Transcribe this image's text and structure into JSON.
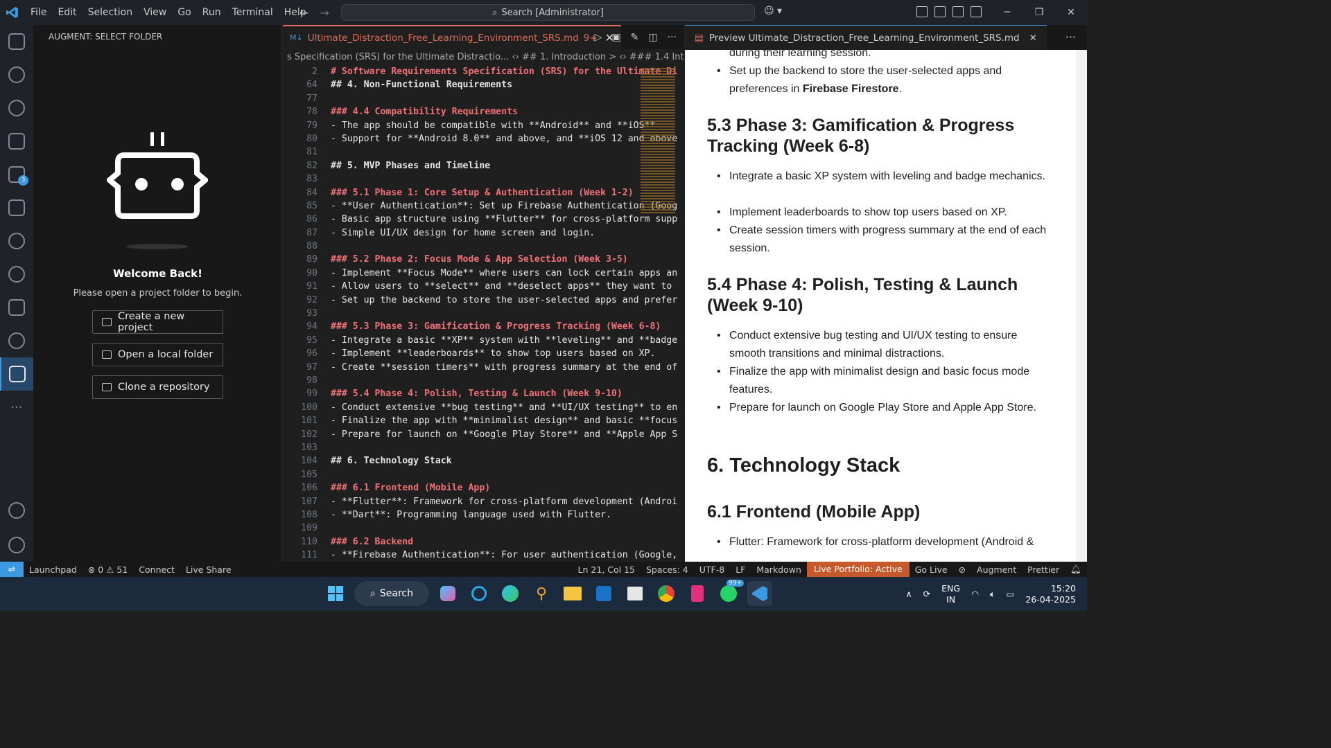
{
  "menu": [
    "File",
    "Edit",
    "Selection",
    "View",
    "Go",
    "Run",
    "Terminal",
    "Help"
  ],
  "search": "Search [Administrator]",
  "sidebar": {
    "title": "AUGMENT: SELECT FOLDER",
    "welcome": "Welcome Back!",
    "subtitle": "Please open a project folder to begin.",
    "buttons": [
      "Create a new project",
      "Open a local folder",
      "Clone a repository"
    ],
    "extensions_badge": "3"
  },
  "editor": {
    "tab_label": "Ultimate_Distraction_Free_Learning_Environment_SRS.md",
    "tab_badge": "9+",
    "breadcrumb": "s Specification (SRS) for the Ultimate Distractio...  ‹› ## 1. Introduction  >  ‹› ### 1.4 Intended Au",
    "lines": [
      {
        "n": "2",
        "t": "# Software Requirements Specification (SRS) for the Ultimate Di",
        "k": "h1"
      },
      {
        "n": "64",
        "t": "## 4. Non-Functional Requirements",
        "k": "h2"
      },
      {
        "n": "77",
        "t": "",
        "k": ""
      },
      {
        "n": "78",
        "t": "### 4.4 Compatibility Requirements",
        "k": "h3"
      },
      {
        "n": "79",
        "t": "- The app should be compatible with **Android** and **iOS**",
        "k": "li"
      },
      {
        "n": "80",
        "t": "- Support for **Android 8.0** and above, and **iOS 12 and above",
        "k": "li"
      },
      {
        "n": "81",
        "t": "",
        "k": ""
      },
      {
        "n": "82",
        "t": "## 5. MVP Phases and Timeline",
        "k": "h2"
      },
      {
        "n": "83",
        "t": "",
        "k": ""
      },
      {
        "n": "84",
        "t": "### 5.1 Phase 1: Core Setup & Authentication (Week 1-2)",
        "k": "h3"
      },
      {
        "n": "85",
        "t": "- **User Authentication**: Set up Firebase Authentication (Goog",
        "k": "li"
      },
      {
        "n": "86",
        "t": "- Basic app structure using **Flutter** for cross-platform supp",
        "k": "li"
      },
      {
        "n": "87",
        "t": "- Simple UI/UX design for home screen and login.",
        "k": "li"
      },
      {
        "n": "88",
        "t": "",
        "k": ""
      },
      {
        "n": "89",
        "t": "### 5.2 Phase 2: Focus Mode & App Selection (Week 3-5)",
        "k": "h3"
      },
      {
        "n": "90",
        "t": "- Implement **Focus Mode** where users can lock certain apps an",
        "k": "li"
      },
      {
        "n": "91",
        "t": "- Allow users to **select** and **deselect apps** they want to",
        "k": "li"
      },
      {
        "n": "92",
        "t": "- Set up the backend to store the user-selected apps and prefer",
        "k": "li"
      },
      {
        "n": "93",
        "t": "",
        "k": ""
      },
      {
        "n": "94",
        "t": "### 5.3 Phase 3: Gamification & Progress Tracking (Week 6-8)",
        "k": "h3"
      },
      {
        "n": "95",
        "t": "- Integrate a basic **XP** system with **leveling** and **badge",
        "k": "li"
      },
      {
        "n": "96",
        "t": "- Implement **leaderboards** to show top users based on XP.",
        "k": "li"
      },
      {
        "n": "97",
        "t": "- Create **session timers** with progress summary at the end of",
        "k": "li"
      },
      {
        "n": "98",
        "t": "",
        "k": ""
      },
      {
        "n": "99",
        "t": "### 5.4 Phase 4: Polish, Testing & Launch (Week 9-10)",
        "k": "h3"
      },
      {
        "n": "100",
        "t": "- Conduct extensive **bug testing** and **UI/UX testing** to en",
        "k": "li"
      },
      {
        "n": "101",
        "t": "- Finalize the app with **minimalist design** and basic **focus",
        "k": "li"
      },
      {
        "n": "102",
        "t": "- Prepare for launch on **Google Play Store** and **Apple App S",
        "k": "li"
      },
      {
        "n": "103",
        "t": "",
        "k": ""
      },
      {
        "n": "104",
        "t": "## 6. Technology Stack",
        "k": "h2"
      },
      {
        "n": "105",
        "t": "",
        "k": ""
      },
      {
        "n": "106",
        "t": "### 6.1 Frontend (Mobile App)",
        "k": "h3"
      },
      {
        "n": "107",
        "t": "- **Flutter**: Framework for cross-platform development (Androi",
        "k": "li"
      },
      {
        "n": "108",
        "t": "- **Dart**: Programming language used with Flutter.",
        "k": "li"
      },
      {
        "n": "109",
        "t": "",
        "k": ""
      },
      {
        "n": "110",
        "t": "### 6.2 Backend",
        "k": "h3"
      },
      {
        "n": "111",
        "t": "- **Firebase Authentication**: For user authentication (Google,",
        "k": "li"
      }
    ]
  },
  "preview": {
    "tab_label": "Preview Ultimate_Distraction_Free_Learning_Environment_SRS.md",
    "p_top": "during their learning session.",
    "p_backend_a": "Set up the backend to store the user-selected apps and preferences in ",
    "p_backend_b": "Firebase Firestore",
    "h53": "5.3 Phase 3: Gamification & Progress Tracking (Week 6-8)",
    "p53a": "Integrate a basic XP system with leveling and badge mechanics.",
    "p53b": "Implement leaderboards to show top users based on XP.",
    "p53c": "Create session timers with progress summary at the end of each session.",
    "h54": "5.4 Phase 4: Polish, Testing & Launch (Week 9-10)",
    "p54a": "Conduct extensive bug testing and UI/UX testing to ensure smooth transitions and minimal distractions.",
    "p54b": "Finalize the app with minimalist design and basic focus mode features.",
    "p54c": "Prepare for launch on Google Play Store and Apple App Store.",
    "h6": "6. Technology Stack",
    "h61": "6.1 Frontend (Mobile App)",
    "p61": "Flutter: Framework for cross-platform development (Android &"
  },
  "status": {
    "launchpad": "Launchpad",
    "problems": "⊗ 0 ⚠ 51",
    "connect": "Connect",
    "liveshare": "Live Share",
    "position": "Ln 21, Col 15",
    "spaces": "Spaces: 4",
    "encoding": "UTF-8",
    "eol": "LF",
    "language": "Markdown",
    "portfolio": "Live Portfolio: Active",
    "golive": "Go Live",
    "augment": "Augment",
    "prettier": "Prettier"
  },
  "taskbar": {
    "search": "Search",
    "whatsapp_badge": "99+",
    "lang1": "ENG",
    "lang2": "IN",
    "time": "15:20",
    "date": "26-04-2025"
  },
  "colors": {
    "accent": "#3b9ae1",
    "heading": "#f07178",
    "live": "#c5592c",
    "tab": "#e06c5a"
  }
}
